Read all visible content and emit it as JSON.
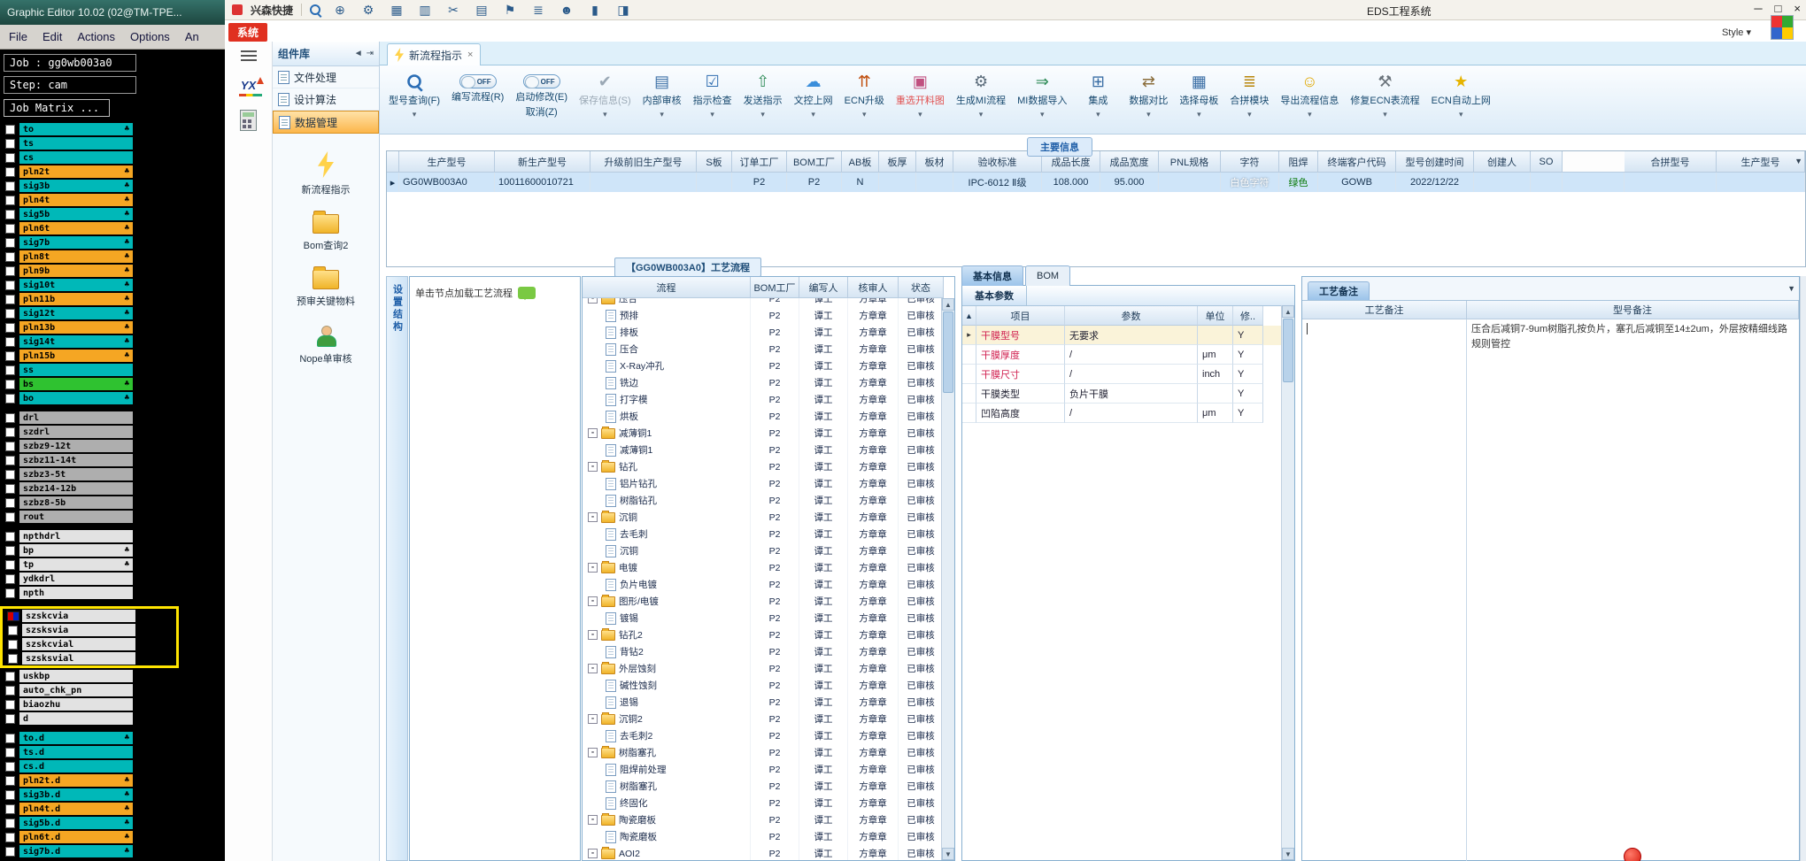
{
  "accent_colors": {
    "highlight_yellow": "#ffe400",
    "param_red": "#d02050",
    "layer_teal": "#00b8b8",
    "layer_orange": "#f5a623",
    "layer_green": "#2fc230",
    "selected_row_blue": "#cfe5f9",
    "system_badge_red": "#e03020"
  },
  "cam_editor": {
    "title": "Graphic Editor 10.02 (02@TM-TPE...",
    "menu": [
      "File",
      "Edit",
      "Actions",
      "Options",
      "An"
    ],
    "job_label": "Job : gg0wb003a0",
    "step_label": "Step: cam",
    "matrix_button": "Job Matrix ...",
    "layers": [
      {
        "n": "to",
        "c": "teal",
        "s": true
      },
      {
        "n": "ts",
        "c": "teal",
        "s": false
      },
      {
        "n": "cs",
        "c": "teal",
        "s": false
      },
      {
        "n": "pln2t",
        "c": "orange",
        "s": true
      },
      {
        "n": "sig3b",
        "c": "teal",
        "s": true
      },
      {
        "n": "pln4t",
        "c": "orange",
        "s": true
      },
      {
        "n": "sig5b",
        "c": "teal",
        "s": true
      },
      {
        "n": "pln6t",
        "c": "orange",
        "s": true
      },
      {
        "n": "sig7b",
        "c": "teal",
        "s": true
      },
      {
        "n": "pln8t",
        "c": "orange",
        "s": true
      },
      {
        "n": "pln9b",
        "c": "orange",
        "s": true
      },
      {
        "n": "sig10t",
        "c": "teal",
        "s": true
      },
      {
        "n": "pln11b",
        "c": "orange",
        "s": true
      },
      {
        "n": "sig12t",
        "c": "teal",
        "s": true
      },
      {
        "n": "pln13b",
        "c": "orange",
        "s": true
      },
      {
        "n": "sig14t",
        "c": "teal",
        "s": true
      },
      {
        "n": "pln15b",
        "c": "orange",
        "s": true
      },
      {
        "n": "ss",
        "c": "teal",
        "s": false
      },
      {
        "n": "bs",
        "c": "green",
        "s": true
      },
      {
        "n": "bo",
        "c": "teal",
        "s": true,
        "gap": true
      },
      {
        "n": "drl",
        "c": "gray",
        "s": false
      },
      {
        "n": "szdrl",
        "c": "gray",
        "s": false
      },
      {
        "n": "szbz9-12t",
        "c": "gray",
        "s": false
      },
      {
        "n": "szbz11-14t",
        "c": "gray",
        "s": false
      },
      {
        "n": "szbz3-5t",
        "c": "gray",
        "s": false
      },
      {
        "n": "szbz14-12b",
        "c": "gray",
        "s": false
      },
      {
        "n": "szbz8-5b",
        "c": "gray",
        "s": false
      },
      {
        "n": "rout",
        "c": "gray",
        "s": false,
        "gap": true
      },
      {
        "n": "npthdrl",
        "c": "light",
        "s": false
      },
      {
        "n": "bp",
        "c": "light",
        "s": true
      },
      {
        "n": "tp",
        "c": "light",
        "s": true
      },
      {
        "n": "ydkdrl",
        "c": "light",
        "s": false
      },
      {
        "n": "npth",
        "c": "light",
        "s": false,
        "gap": true
      },
      {
        "n": "szskcvia",
        "c": "light",
        "s": false,
        "h": true,
        "active": true
      },
      {
        "n": "szsksvia",
        "c": "light",
        "s": false,
        "h": true
      },
      {
        "n": "szskcvial",
        "c": "light",
        "s": false,
        "h": true
      },
      {
        "n": "szsksvial",
        "c": "light",
        "s": false,
        "h": true
      },
      {
        "n": "uskbp",
        "c": "light",
        "s": false
      },
      {
        "n": "auto_chk_pn",
        "c": "light",
        "s": false
      },
      {
        "n": "biaozhu",
        "c": "light",
        "s": false
      },
      {
        "n": "d",
        "c": "light",
        "s": false,
        "gap": true
      },
      {
        "n": "to.d",
        "c": "teal",
        "s": true
      },
      {
        "n": "ts.d",
        "c": "teal",
        "s": false
      },
      {
        "n": "cs.d",
        "c": "teal",
        "s": false
      },
      {
        "n": "pln2t.d",
        "c": "orange",
        "s": true
      },
      {
        "n": "sig3b.d",
        "c": "teal",
        "s": true
      },
      {
        "n": "pln4t.d",
        "c": "orange",
        "s": true
      },
      {
        "n": "sig5b.d",
        "c": "teal",
        "s": true
      },
      {
        "n": "pln6t.d",
        "c": "orange",
        "s": true
      },
      {
        "n": "sig7b.d",
        "c": "teal",
        "s": true
      }
    ]
  },
  "quick_toolbar": {
    "label": "兴森快捷",
    "icons": [
      "search",
      "globe",
      "gear",
      "grid",
      "cells",
      "scissors",
      "table",
      "flag",
      "lines",
      "user",
      "chart",
      "cube"
    ]
  },
  "titlebar": {
    "title": "EDS工程系统",
    "style_label": "Style",
    "window_controls": [
      "minimize",
      "maximize",
      "close"
    ]
  },
  "app": {
    "system_badge": "系统",
    "panel": {
      "tab": "组件库",
      "nav_items": [
        "文件处理",
        "设计算法",
        "数据管理"
      ],
      "active_nav": "数据管理",
      "shortcuts": [
        {
          "label": "新流程指示",
          "icon": "lightning"
        },
        {
          "label": "Bom查询2",
          "icon": "folder"
        },
        {
          "label": "预审关键物料",
          "icon": "folder"
        },
        {
          "label": "Nope单审核",
          "icon": "person"
        }
      ]
    },
    "tab_label": "新流程指示",
    "toolbar": [
      {
        "label": "型号查询(F)",
        "icon": "search",
        "dropdown": true
      },
      {
        "label": "编写流程(R)",
        "toggle": "OFF"
      },
      {
        "label": "启动修改(E)",
        "sub": "取消(Z)",
        "toggle": "OFF"
      },
      {
        "label": "保存信息(S)",
        "icon": "save",
        "disabled": true,
        "dropdown": true
      },
      {
        "label": "内部审核",
        "icon": "audit",
        "dropdown": true
      },
      {
        "label": "指示检查",
        "icon": "inspect",
        "dropdown": true
      },
      {
        "label": "发送指示",
        "icon": "send",
        "dropdown": true
      },
      {
        "label": "文控上网",
        "icon": "cloud",
        "dropdown": true
      },
      {
        "label": "ECN升级",
        "icon": "ecn",
        "dropdown": true
      },
      {
        "label": "重选开料图",
        "icon": "image",
        "danger": true,
        "dropdown": true
      },
      {
        "label": "生成MI流程",
        "icon": "gears",
        "dropdown": true
      },
      {
        "label": "MI数据导入",
        "icon": "import",
        "dropdown": true
      },
      {
        "label": "集成",
        "icon": "integrate",
        "dropdown": true
      },
      {
        "label": "数据对比",
        "icon": "compare",
        "dropdown": true
      },
      {
        "label": "选择母板",
        "icon": "board",
        "dropdown": true
      },
      {
        "label": "合拼模块",
        "icon": "merge",
        "dropdown": true
      },
      {
        "label": "导出流程信息",
        "icon": "export",
        "dropdown": true
      },
      {
        "label": "修复ECN表流程",
        "icon": "repair",
        "dropdown": true
      },
      {
        "label": "ECN自动上网",
        "icon": "star",
        "dropdown": true
      }
    ],
    "main_info": {
      "title": "主要信息",
      "columns": [
        "",
        "生产型号",
        "新生产型号",
        "升级前旧生产型号",
        "S板",
        "订单工厂",
        "BOM工厂",
        "AB板",
        "板厚",
        "板材",
        "验收标准",
        "成品长度",
        "成品宽度",
        "PNL规格",
        "字符",
        "阻焊",
        "终端客户代码",
        "型号创建时间",
        "创建人",
        "SO",
        "",
        "合拼型号",
        "生产型号"
      ],
      "values": [
        "▸",
        "GG0WB003A0",
        "10011600010721",
        "",
        "",
        "P2",
        "P2",
        "N",
        "",
        "",
        "IPC-6012 Ⅱ级",
        "108.000",
        "95.000",
        "",
        "白色字符",
        "绿色",
        "GOWB",
        "2022/12/22",
        "",
        "",
        "",
        "",
        ""
      ]
    },
    "process": {
      "title": "【GG0WB003A0】工艺流程",
      "sidebar_vertical": "设置结构",
      "hint": "单击节点加载工艺流程",
      "columns": [
        "流程",
        "BOM工厂",
        "编写人",
        "核审人",
        "状态"
      ],
      "defaults": {
        "factory": "P2",
        "writer": "谭工",
        "reviewer": "方章章",
        "status": "已审核"
      },
      "rows": [
        {
          "name": "压合",
          "level": 1,
          "folder": true
        },
        {
          "name": "预排",
          "level": 2,
          "folder": false
        },
        {
          "name": "排板",
          "level": 2,
          "folder": false
        },
        {
          "name": "压合",
          "level": 2,
          "folder": false
        },
        {
          "name": "X-Ray冲孔",
          "level": 2,
          "folder": false
        },
        {
          "name": "铣边",
          "level": 2,
          "folder": false
        },
        {
          "name": "打字模",
          "level": 2,
          "folder": false
        },
        {
          "name": "烘板",
          "level": 2,
          "folder": false
        },
        {
          "name": "减薄铜1",
          "level": 1,
          "folder": true
        },
        {
          "name": "减薄铜1",
          "level": 2,
          "folder": false
        },
        {
          "name": "钻孔",
          "level": 1,
          "folder": true
        },
        {
          "name": "铝片钻孔",
          "level": 2,
          "folder": false
        },
        {
          "name": "树脂钻孔",
          "level": 2,
          "folder": false
        },
        {
          "name": "沉铜",
          "level": 1,
          "folder": true
        },
        {
          "name": "去毛刺",
          "level": 2,
          "folder": false
        },
        {
          "name": "沉铜",
          "level": 2,
          "folder": false
        },
        {
          "name": "电镀",
          "level": 1,
          "folder": true
        },
        {
          "name": "负片电镀",
          "level": 2,
          "folder": false
        },
        {
          "name": "图形/电镀",
          "level": 1,
          "folder": true
        },
        {
          "name": "镀锡",
          "level": 2,
          "folder": false
        },
        {
          "name": "钻孔2",
          "level": 1,
          "folder": true
        },
        {
          "name": "背钻2",
          "level": 2,
          "folder": false
        },
        {
          "name": "外层蚀刻",
          "level": 1,
          "folder": true
        },
        {
          "name": "碱性蚀刻",
          "level": 2,
          "folder": false
        },
        {
          "name": "退锡",
          "level": 2,
          "folder": false
        },
        {
          "name": "沉铜2",
          "level": 1,
          "folder": true
        },
        {
          "name": "去毛刺2",
          "level": 2,
          "folder": false
        },
        {
          "name": "树脂塞孔",
          "level": 1,
          "folder": true
        },
        {
          "name": "阻焊前处理",
          "level": 2,
          "folder": false
        },
        {
          "name": "树脂塞孔",
          "level": 2,
          "folder": false
        },
        {
          "name": "终固化",
          "level": 2,
          "folder": false
        },
        {
          "name": "陶瓷磨板",
          "level": 1,
          "folder": true
        },
        {
          "name": "陶瓷磨板",
          "level": 2,
          "folder": false
        },
        {
          "name": "AOI2",
          "level": 1,
          "folder": true
        }
      ]
    },
    "params": {
      "tab_basic": "基本信息",
      "tab_bom": "BOM",
      "subtab": "基本参数",
      "columns": [
        "项目",
        "参数",
        "单位",
        "修.."
      ],
      "rows": [
        {
          "item": "干膜型号",
          "value": "无要求",
          "unit": "",
          "mod": "Y",
          "red": true,
          "selected": true
        },
        {
          "item": "干膜厚度",
          "value": "/",
          "unit": "μm",
          "mod": "Y",
          "red": true
        },
        {
          "item": "干膜尺寸",
          "value": "/",
          "unit": "inch",
          "mod": "Y",
          "red": true
        },
        {
          "item": "干膜类型",
          "value": "负片干膜",
          "unit": "",
          "mod": "Y",
          "red": false
        },
        {
          "item": "凹陷高度",
          "value": "/",
          "unit": "μm",
          "mod": "Y",
          "red": false
        }
      ]
    },
    "remarks": {
      "tab": "工艺备注",
      "col_process": "工艺备注",
      "col_model": "型号备注",
      "model_remark": "压合后减铜7-9um树脂孔按负片，塞孔后减铜至14±2um，外层按精细线路规则管控"
    }
  }
}
